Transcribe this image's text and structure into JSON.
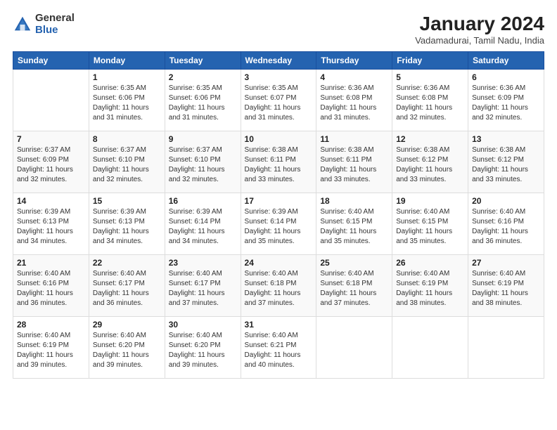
{
  "logo": {
    "general": "General",
    "blue": "Blue"
  },
  "title": "January 2024",
  "subtitle": "Vadamadurai, Tamil Nadu, India",
  "days_header": [
    "Sunday",
    "Monday",
    "Tuesday",
    "Wednesday",
    "Thursday",
    "Friday",
    "Saturday"
  ],
  "weeks": [
    [
      {
        "num": "",
        "lines": []
      },
      {
        "num": "1",
        "lines": [
          "Sunrise: 6:35 AM",
          "Sunset: 6:06 PM",
          "Daylight: 11 hours",
          "and 31 minutes."
        ]
      },
      {
        "num": "2",
        "lines": [
          "Sunrise: 6:35 AM",
          "Sunset: 6:06 PM",
          "Daylight: 11 hours",
          "and 31 minutes."
        ]
      },
      {
        "num": "3",
        "lines": [
          "Sunrise: 6:35 AM",
          "Sunset: 6:07 PM",
          "Daylight: 11 hours",
          "and 31 minutes."
        ]
      },
      {
        "num": "4",
        "lines": [
          "Sunrise: 6:36 AM",
          "Sunset: 6:08 PM",
          "Daylight: 11 hours",
          "and 31 minutes."
        ]
      },
      {
        "num": "5",
        "lines": [
          "Sunrise: 6:36 AM",
          "Sunset: 6:08 PM",
          "Daylight: 11 hours",
          "and 32 minutes."
        ]
      },
      {
        "num": "6",
        "lines": [
          "Sunrise: 6:36 AM",
          "Sunset: 6:09 PM",
          "Daylight: 11 hours",
          "and 32 minutes."
        ]
      }
    ],
    [
      {
        "num": "7",
        "lines": [
          "Sunrise: 6:37 AM",
          "Sunset: 6:09 PM",
          "Daylight: 11 hours",
          "and 32 minutes."
        ]
      },
      {
        "num": "8",
        "lines": [
          "Sunrise: 6:37 AM",
          "Sunset: 6:10 PM",
          "Daylight: 11 hours",
          "and 32 minutes."
        ]
      },
      {
        "num": "9",
        "lines": [
          "Sunrise: 6:37 AM",
          "Sunset: 6:10 PM",
          "Daylight: 11 hours",
          "and 32 minutes."
        ]
      },
      {
        "num": "10",
        "lines": [
          "Sunrise: 6:38 AM",
          "Sunset: 6:11 PM",
          "Daylight: 11 hours",
          "and 33 minutes."
        ]
      },
      {
        "num": "11",
        "lines": [
          "Sunrise: 6:38 AM",
          "Sunset: 6:11 PM",
          "Daylight: 11 hours",
          "and 33 minutes."
        ]
      },
      {
        "num": "12",
        "lines": [
          "Sunrise: 6:38 AM",
          "Sunset: 6:12 PM",
          "Daylight: 11 hours",
          "and 33 minutes."
        ]
      },
      {
        "num": "13",
        "lines": [
          "Sunrise: 6:38 AM",
          "Sunset: 6:12 PM",
          "Daylight: 11 hours",
          "and 33 minutes."
        ]
      }
    ],
    [
      {
        "num": "14",
        "lines": [
          "Sunrise: 6:39 AM",
          "Sunset: 6:13 PM",
          "Daylight: 11 hours",
          "and 34 minutes."
        ]
      },
      {
        "num": "15",
        "lines": [
          "Sunrise: 6:39 AM",
          "Sunset: 6:13 PM",
          "Daylight: 11 hours",
          "and 34 minutes."
        ]
      },
      {
        "num": "16",
        "lines": [
          "Sunrise: 6:39 AM",
          "Sunset: 6:14 PM",
          "Daylight: 11 hours",
          "and 34 minutes."
        ]
      },
      {
        "num": "17",
        "lines": [
          "Sunrise: 6:39 AM",
          "Sunset: 6:14 PM",
          "Daylight: 11 hours",
          "and 35 minutes."
        ]
      },
      {
        "num": "18",
        "lines": [
          "Sunrise: 6:40 AM",
          "Sunset: 6:15 PM",
          "Daylight: 11 hours",
          "and 35 minutes."
        ]
      },
      {
        "num": "19",
        "lines": [
          "Sunrise: 6:40 AM",
          "Sunset: 6:15 PM",
          "Daylight: 11 hours",
          "and 35 minutes."
        ]
      },
      {
        "num": "20",
        "lines": [
          "Sunrise: 6:40 AM",
          "Sunset: 6:16 PM",
          "Daylight: 11 hours",
          "and 36 minutes."
        ]
      }
    ],
    [
      {
        "num": "21",
        "lines": [
          "Sunrise: 6:40 AM",
          "Sunset: 6:16 PM",
          "Daylight: 11 hours",
          "and 36 minutes."
        ]
      },
      {
        "num": "22",
        "lines": [
          "Sunrise: 6:40 AM",
          "Sunset: 6:17 PM",
          "Daylight: 11 hours",
          "and 36 minutes."
        ]
      },
      {
        "num": "23",
        "lines": [
          "Sunrise: 6:40 AM",
          "Sunset: 6:17 PM",
          "Daylight: 11 hours",
          "and 37 minutes."
        ]
      },
      {
        "num": "24",
        "lines": [
          "Sunrise: 6:40 AM",
          "Sunset: 6:18 PM",
          "Daylight: 11 hours",
          "and 37 minutes."
        ]
      },
      {
        "num": "25",
        "lines": [
          "Sunrise: 6:40 AM",
          "Sunset: 6:18 PM",
          "Daylight: 11 hours",
          "and 37 minutes."
        ]
      },
      {
        "num": "26",
        "lines": [
          "Sunrise: 6:40 AM",
          "Sunset: 6:19 PM",
          "Daylight: 11 hours",
          "and 38 minutes."
        ]
      },
      {
        "num": "27",
        "lines": [
          "Sunrise: 6:40 AM",
          "Sunset: 6:19 PM",
          "Daylight: 11 hours",
          "and 38 minutes."
        ]
      }
    ],
    [
      {
        "num": "28",
        "lines": [
          "Sunrise: 6:40 AM",
          "Sunset: 6:19 PM",
          "Daylight: 11 hours",
          "and 39 minutes."
        ]
      },
      {
        "num": "29",
        "lines": [
          "Sunrise: 6:40 AM",
          "Sunset: 6:20 PM",
          "Daylight: 11 hours",
          "and 39 minutes."
        ]
      },
      {
        "num": "30",
        "lines": [
          "Sunrise: 6:40 AM",
          "Sunset: 6:20 PM",
          "Daylight: 11 hours",
          "and 39 minutes."
        ]
      },
      {
        "num": "31",
        "lines": [
          "Sunrise: 6:40 AM",
          "Sunset: 6:21 PM",
          "Daylight: 11 hours",
          "and 40 minutes."
        ]
      },
      {
        "num": "",
        "lines": []
      },
      {
        "num": "",
        "lines": []
      },
      {
        "num": "",
        "lines": []
      }
    ]
  ]
}
